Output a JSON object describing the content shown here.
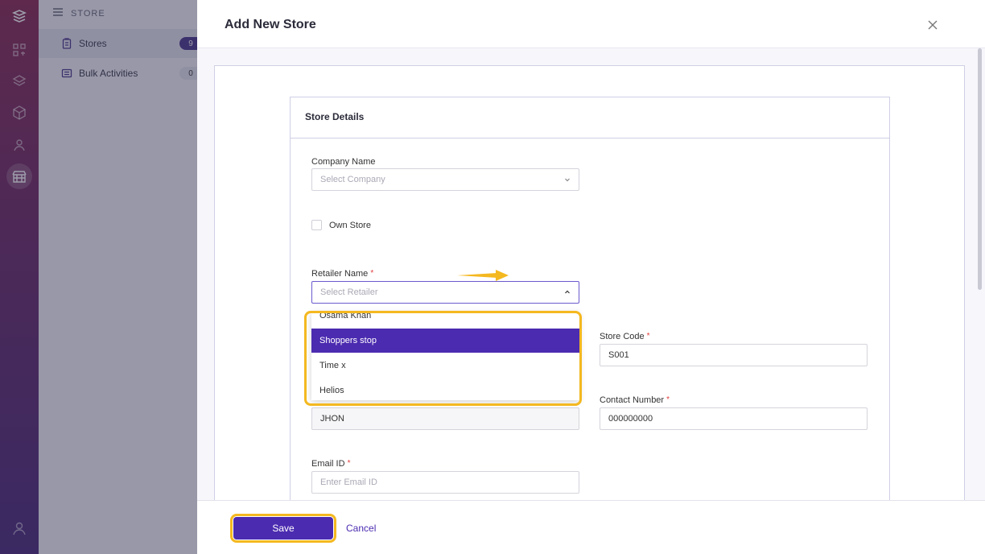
{
  "sidebar": {
    "section_title": "STORE",
    "items": [
      {
        "label": "Stores",
        "count": "9"
      },
      {
        "label": "Bulk Activities",
        "count": "0"
      }
    ]
  },
  "drawer": {
    "title": "Add New Store",
    "section_title": "Store Details"
  },
  "form": {
    "company_name": {
      "label": "Company Name",
      "placeholder": "Select Company"
    },
    "own_store": {
      "label": "Own Store",
      "checked": false
    },
    "retailer_name": {
      "label": "Retailer Name",
      "required_mark": "*",
      "placeholder": "Select Retailer"
    },
    "store_code": {
      "label": "Store Code",
      "required_mark": "*",
      "value": "S001"
    },
    "contact_name": {
      "value": "JHON"
    },
    "contact_number": {
      "label": "Contact Number",
      "required_mark": "*",
      "value": "000000000"
    },
    "email": {
      "label": "Email ID",
      "required_mark": "*",
      "placeholder": "Enter Email ID"
    }
  },
  "retailer_dropdown": {
    "options": [
      "Osama Khan",
      "Shoppers stop",
      "Time x",
      "Helios"
    ],
    "highlighted": "Shoppers stop"
  },
  "footer": {
    "save_label": "Save",
    "cancel_label": "Cancel"
  },
  "colors": {
    "accent": "#4b2bb0",
    "highlight": "#f4b820",
    "required": "#e23b3b"
  }
}
